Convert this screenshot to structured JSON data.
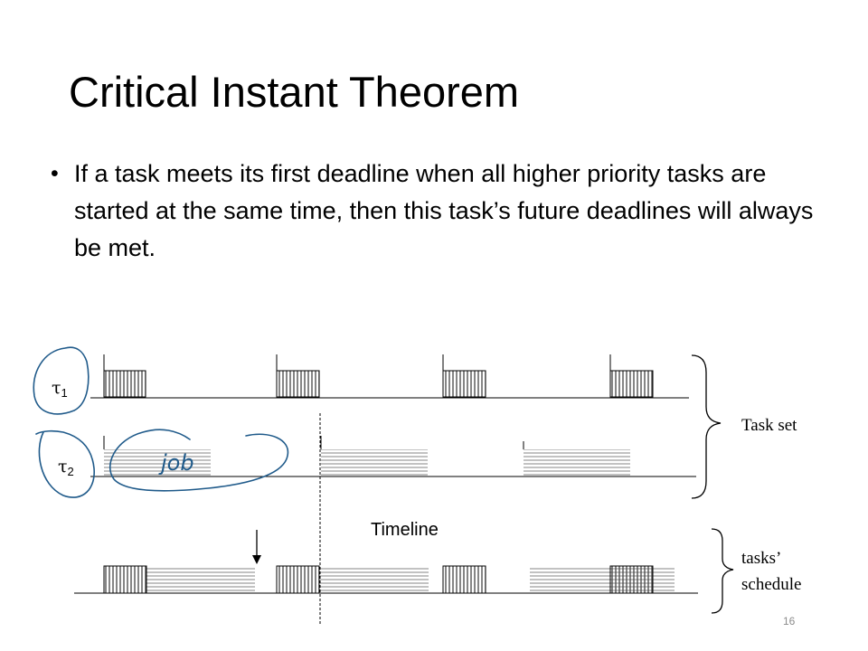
{
  "slide": {
    "title": "Critical Instant Theorem",
    "bullet": "If a task meets its first deadline when all higher priority tasks are started at the same time,  then this task’s future deadlines will always be met.",
    "page_number": "16"
  },
  "diagram": {
    "tasks": [
      {
        "symbol": "τ",
        "subscript": "1",
        "pattern": "vertical-hatch"
      },
      {
        "symbol": "τ",
        "subscript": "2",
        "pattern": "horizontal-hatch"
      }
    ],
    "labels": {
      "task_set": "Task set",
      "timeline": "Timeline",
      "schedule_line1": "tasks’",
      "schedule_line2": "schedule"
    },
    "handwritten_annotation": "job",
    "colors": {
      "ink_annotation": "#1f5a8a",
      "hatch": "#444444",
      "horizontal_hatch": "#9a9a9a"
    }
  }
}
